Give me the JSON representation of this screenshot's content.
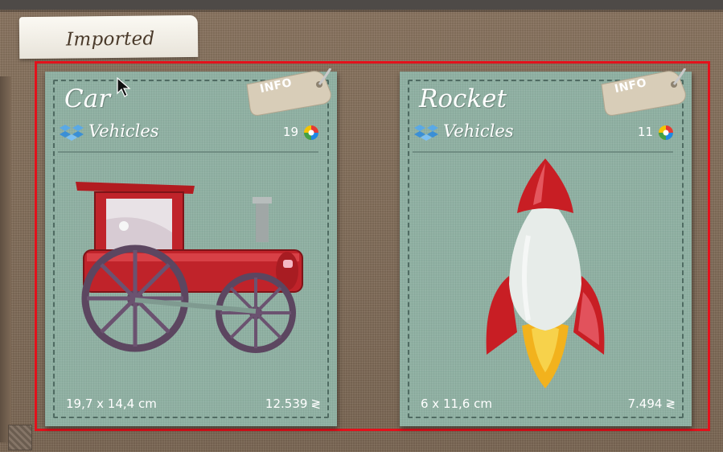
{
  "section_tab": {
    "label": "Imported"
  },
  "cards": [
    {
      "title": "Car",
      "info_label": "INFO",
      "category": "Vehicles",
      "count": "19",
      "size": "19,7 x 14,4 cm",
      "stitches": "12.539",
      "stitch_symbol": "≷",
      "category_icon": "dropbox-icon",
      "count_icon": "colorwheel-icon",
      "artwork": "steam-car-embroidery"
    },
    {
      "title": "Rocket",
      "info_label": "INFO",
      "category": "Vehicles",
      "count": "11",
      "size": "6 x 11,6 cm",
      "stitches": "7.494",
      "stitch_symbol": "≷",
      "category_icon": "dropbox-icon",
      "count_icon": "colorwheel-icon",
      "artwork": "rocket-embroidery"
    }
  ],
  "colors": {
    "card_bg": "#8fb0a2",
    "selection_border": "#e3111b",
    "background": "#897460"
  }
}
